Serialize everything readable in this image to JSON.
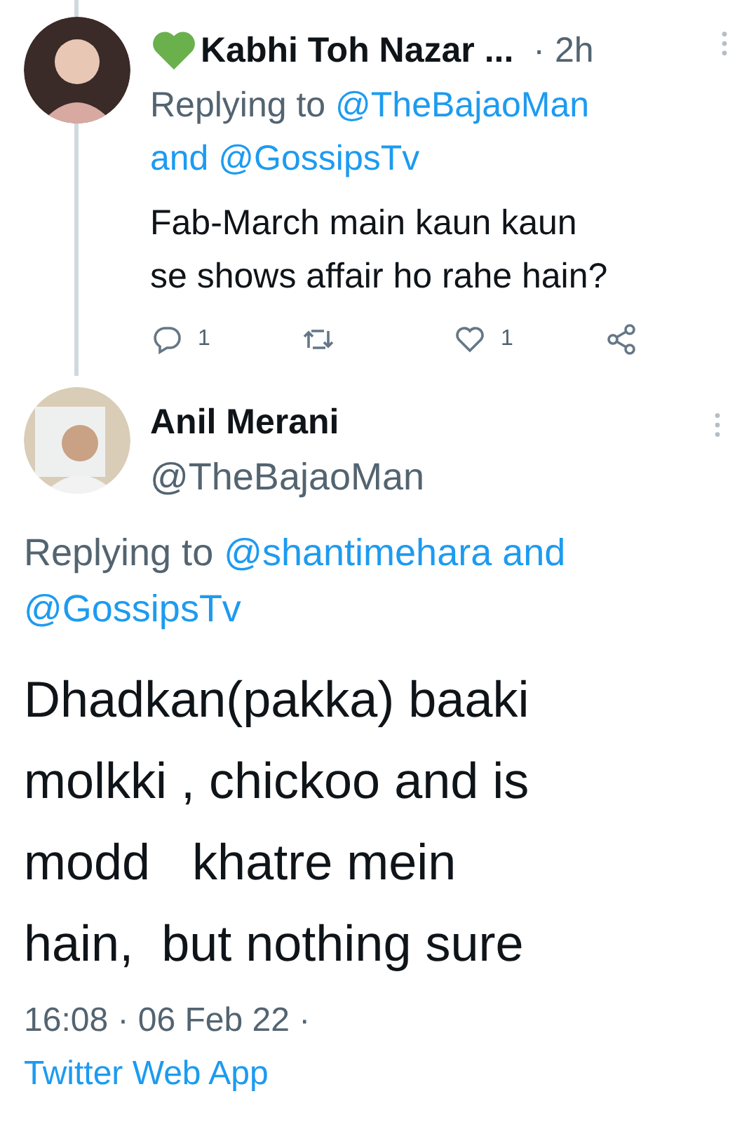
{
  "reply_tweet": {
    "name": "Kabhi Toh Nazar ...",
    "time": "· 2h",
    "replying": {
      "prefix": "Replying to",
      "mentions": [
        "@TheBajaoMan",
        "@GossipsTv"
      ],
      "joiner": "and"
    },
    "text_lines": [
      "Fab-March main kaun kaun",
      "se shows affair ho rahe hain?"
    ],
    "actions": [
      {
        "kind": "reply",
        "count": "1"
      },
      {
        "kind": "retweet"
      },
      {
        "kind": "like",
        "count": "1"
      },
      {
        "kind": "share"
      }
    ]
  },
  "main_tweet": {
    "name": "Anil Merani",
    "handle": "@TheBajaoMan",
    "replying": {
      "prefix": "Replying to",
      "mentions": [
        "@shantimehara",
        "@GossipsTv"
      ],
      "joiner": "and"
    },
    "text_lines": [
      "Dhadkan(pakka) baaki",
      "molkki , chickoo and is",
      "modd   khatre mein",
      "hain,  but nothing sure"
    ],
    "timestamp": "16:08 · 06 Feb 22 ·",
    "source": "Twitter Web App"
  }
}
